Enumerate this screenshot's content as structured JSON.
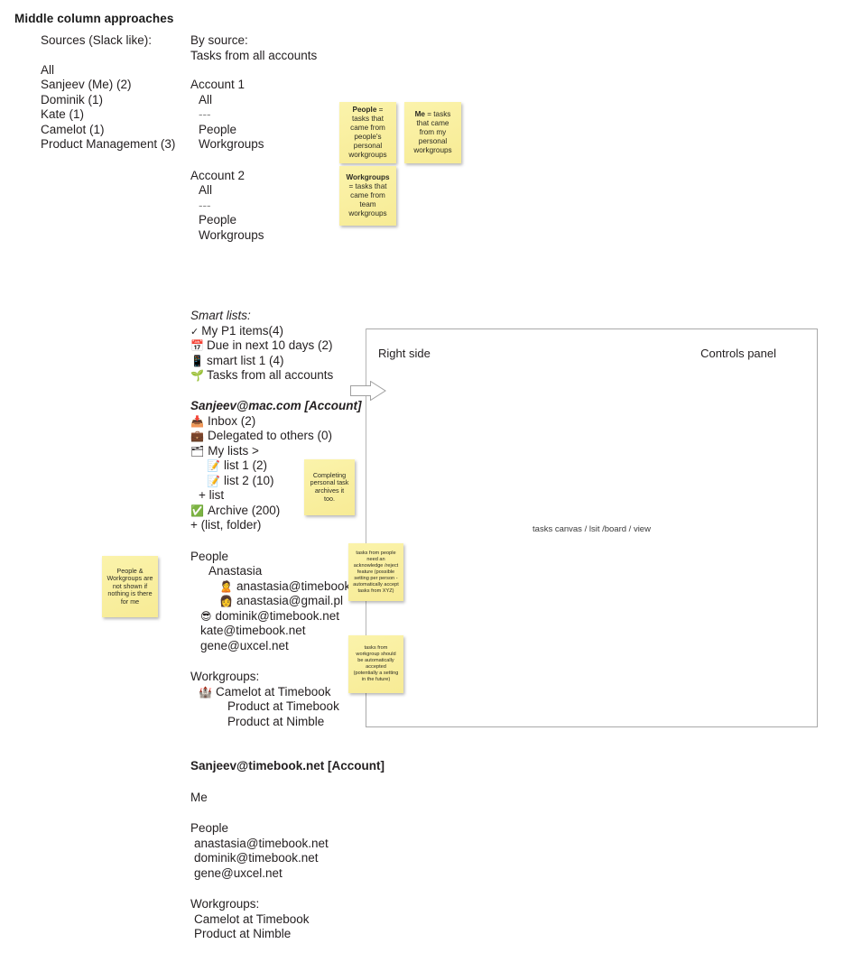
{
  "page": {
    "title": "Middle column approaches"
  },
  "columns": {
    "sources": {
      "heading": "Sources (Slack like):",
      "items": [
        "All",
        "Sanjeev (Me) (2)",
        "Dominik (1)",
        "Kate (1)",
        "Camelot (1)",
        "Product Management (3)"
      ]
    },
    "by_source": {
      "heading": "By source:",
      "subheading": "Tasks from all accounts",
      "accounts": [
        {
          "name": "Account 1",
          "all_label": "All",
          "divider": "---",
          "items": [
            "People",
            "Workgroups"
          ]
        },
        {
          "name": "Account 2",
          "all_label": "All",
          "divider": "---",
          "items": [
            "People",
            "Workgroups"
          ]
        }
      ]
    }
  },
  "notes": {
    "people_def": {
      "term": "People",
      "body": " = tasks that came from people's personal workgroups"
    },
    "me_def": {
      "term": "Me",
      "body": " = tasks that came from my personal workgroups"
    },
    "workgroups_def": {
      "term": "Workgroups",
      "body": " = tasks that came from team workgroups"
    },
    "completing": "Completing personal task archives it too.",
    "people_workgroups_hidden": "People & Workgroups are not shown if nothing is there for me",
    "acknowledge": "tasks from people need an acknowledge /reject feature (possible setting per person - automatically accept tasks from XYZ)",
    "auto_accept": "tasks from workgroup should be automatically accepted (potentially a setting in the future)"
  },
  "smart_lists": {
    "heading": "Smart lists:",
    "items": [
      {
        "icon": "check-icon",
        "glyph": "✓",
        "label": "My P1 items(4)"
      },
      {
        "icon": "calendar-icon",
        "glyph": "📅",
        "label": "Due in next 10 days (2)"
      },
      {
        "icon": "mobile-phone-icon",
        "glyph": "📱",
        "label": "smart list 1 (4)"
      },
      {
        "icon": "seedling-icon",
        "glyph": "🌱",
        "label": "Tasks from all accounts"
      }
    ]
  },
  "account_mac": {
    "heading": "Sanjeev@mac.com [Account]",
    "nav": [
      {
        "icon": "inbox-tray-icon",
        "glyph": "📥",
        "label": "Inbox (2)",
        "indent": 0
      },
      {
        "icon": "briefcase-icon",
        "glyph": "💼",
        "label": "Delegated to others (0)",
        "indent": 0
      },
      {
        "icon": "card-index-dividers-icon",
        "glyph": "🗂",
        "label": "My lists >",
        "indent": 0
      },
      {
        "icon": "memo-icon",
        "glyph": "📝",
        "label": "list 1 (2)",
        "indent": 1
      },
      {
        "icon": "memo-icon",
        "glyph": "📝",
        "label": "list 2 (10)",
        "indent": 1
      },
      {
        "icon": "plus-icon",
        "glyph": "",
        "label": "+ list",
        "indent": 0
      },
      {
        "icon": "check-mark-button-icon",
        "glyph": "✅",
        "label": "Archive (200)",
        "indent": 0
      },
      {
        "icon": "plus-icon",
        "glyph": "",
        "label": "+ (list, folder)",
        "indent": 0
      }
    ],
    "people_heading": "People",
    "people": [
      {
        "icon": "",
        "glyph": "",
        "label": "Anastasia",
        "indent": 0
      },
      {
        "icon": "woman-icon",
        "glyph": "🙎",
        "label": "anastasia@timebook.net",
        "indent": 1
      },
      {
        "icon": "woman-icon",
        "glyph": "👩",
        "label": "anastasia@gmail.pl",
        "indent": 1
      },
      {
        "icon": "sunglasses-face-icon",
        "glyph": "😎",
        "label": "dominik@timebook.net",
        "indent": 0
      },
      {
        "icon": "",
        "glyph": "",
        "label": "kate@timebook.net",
        "indent": 0
      },
      {
        "icon": "",
        "glyph": "",
        "label": "gene@uxcel.net",
        "indent": 0
      }
    ],
    "workgroups_heading": "Workgroups:",
    "workgroups": [
      {
        "icon": "castle-icon",
        "glyph": "🏰",
        "label": "Camelot at Timebook"
      },
      {
        "icon": "",
        "glyph": "",
        "label": "Product at Timebook"
      },
      {
        "icon": "",
        "glyph": "",
        "label": "Product at Nimble"
      }
    ]
  },
  "account_timebook": {
    "heading": "Sanjeev@timebook.net [Account]",
    "me_label": "Me",
    "people_heading": "People",
    "people": [
      "anastasia@timebook.net",
      "dominik@timebook.net",
      "gene@uxcel.net"
    ],
    "workgroups_heading": "Workgroups:",
    "workgroups": [
      "Camelot at Timebook",
      "Product at Nimble"
    ]
  },
  "right_panel": {
    "label": "Right side",
    "controls_label": "Controls panel",
    "center_label": "tasks canvas / lsit /board / view"
  },
  "colors": {
    "note_bg": "#faf0a0",
    "panel_border": "#a9a9a9",
    "text": "#231f20",
    "connector": "#b5b5b5"
  }
}
